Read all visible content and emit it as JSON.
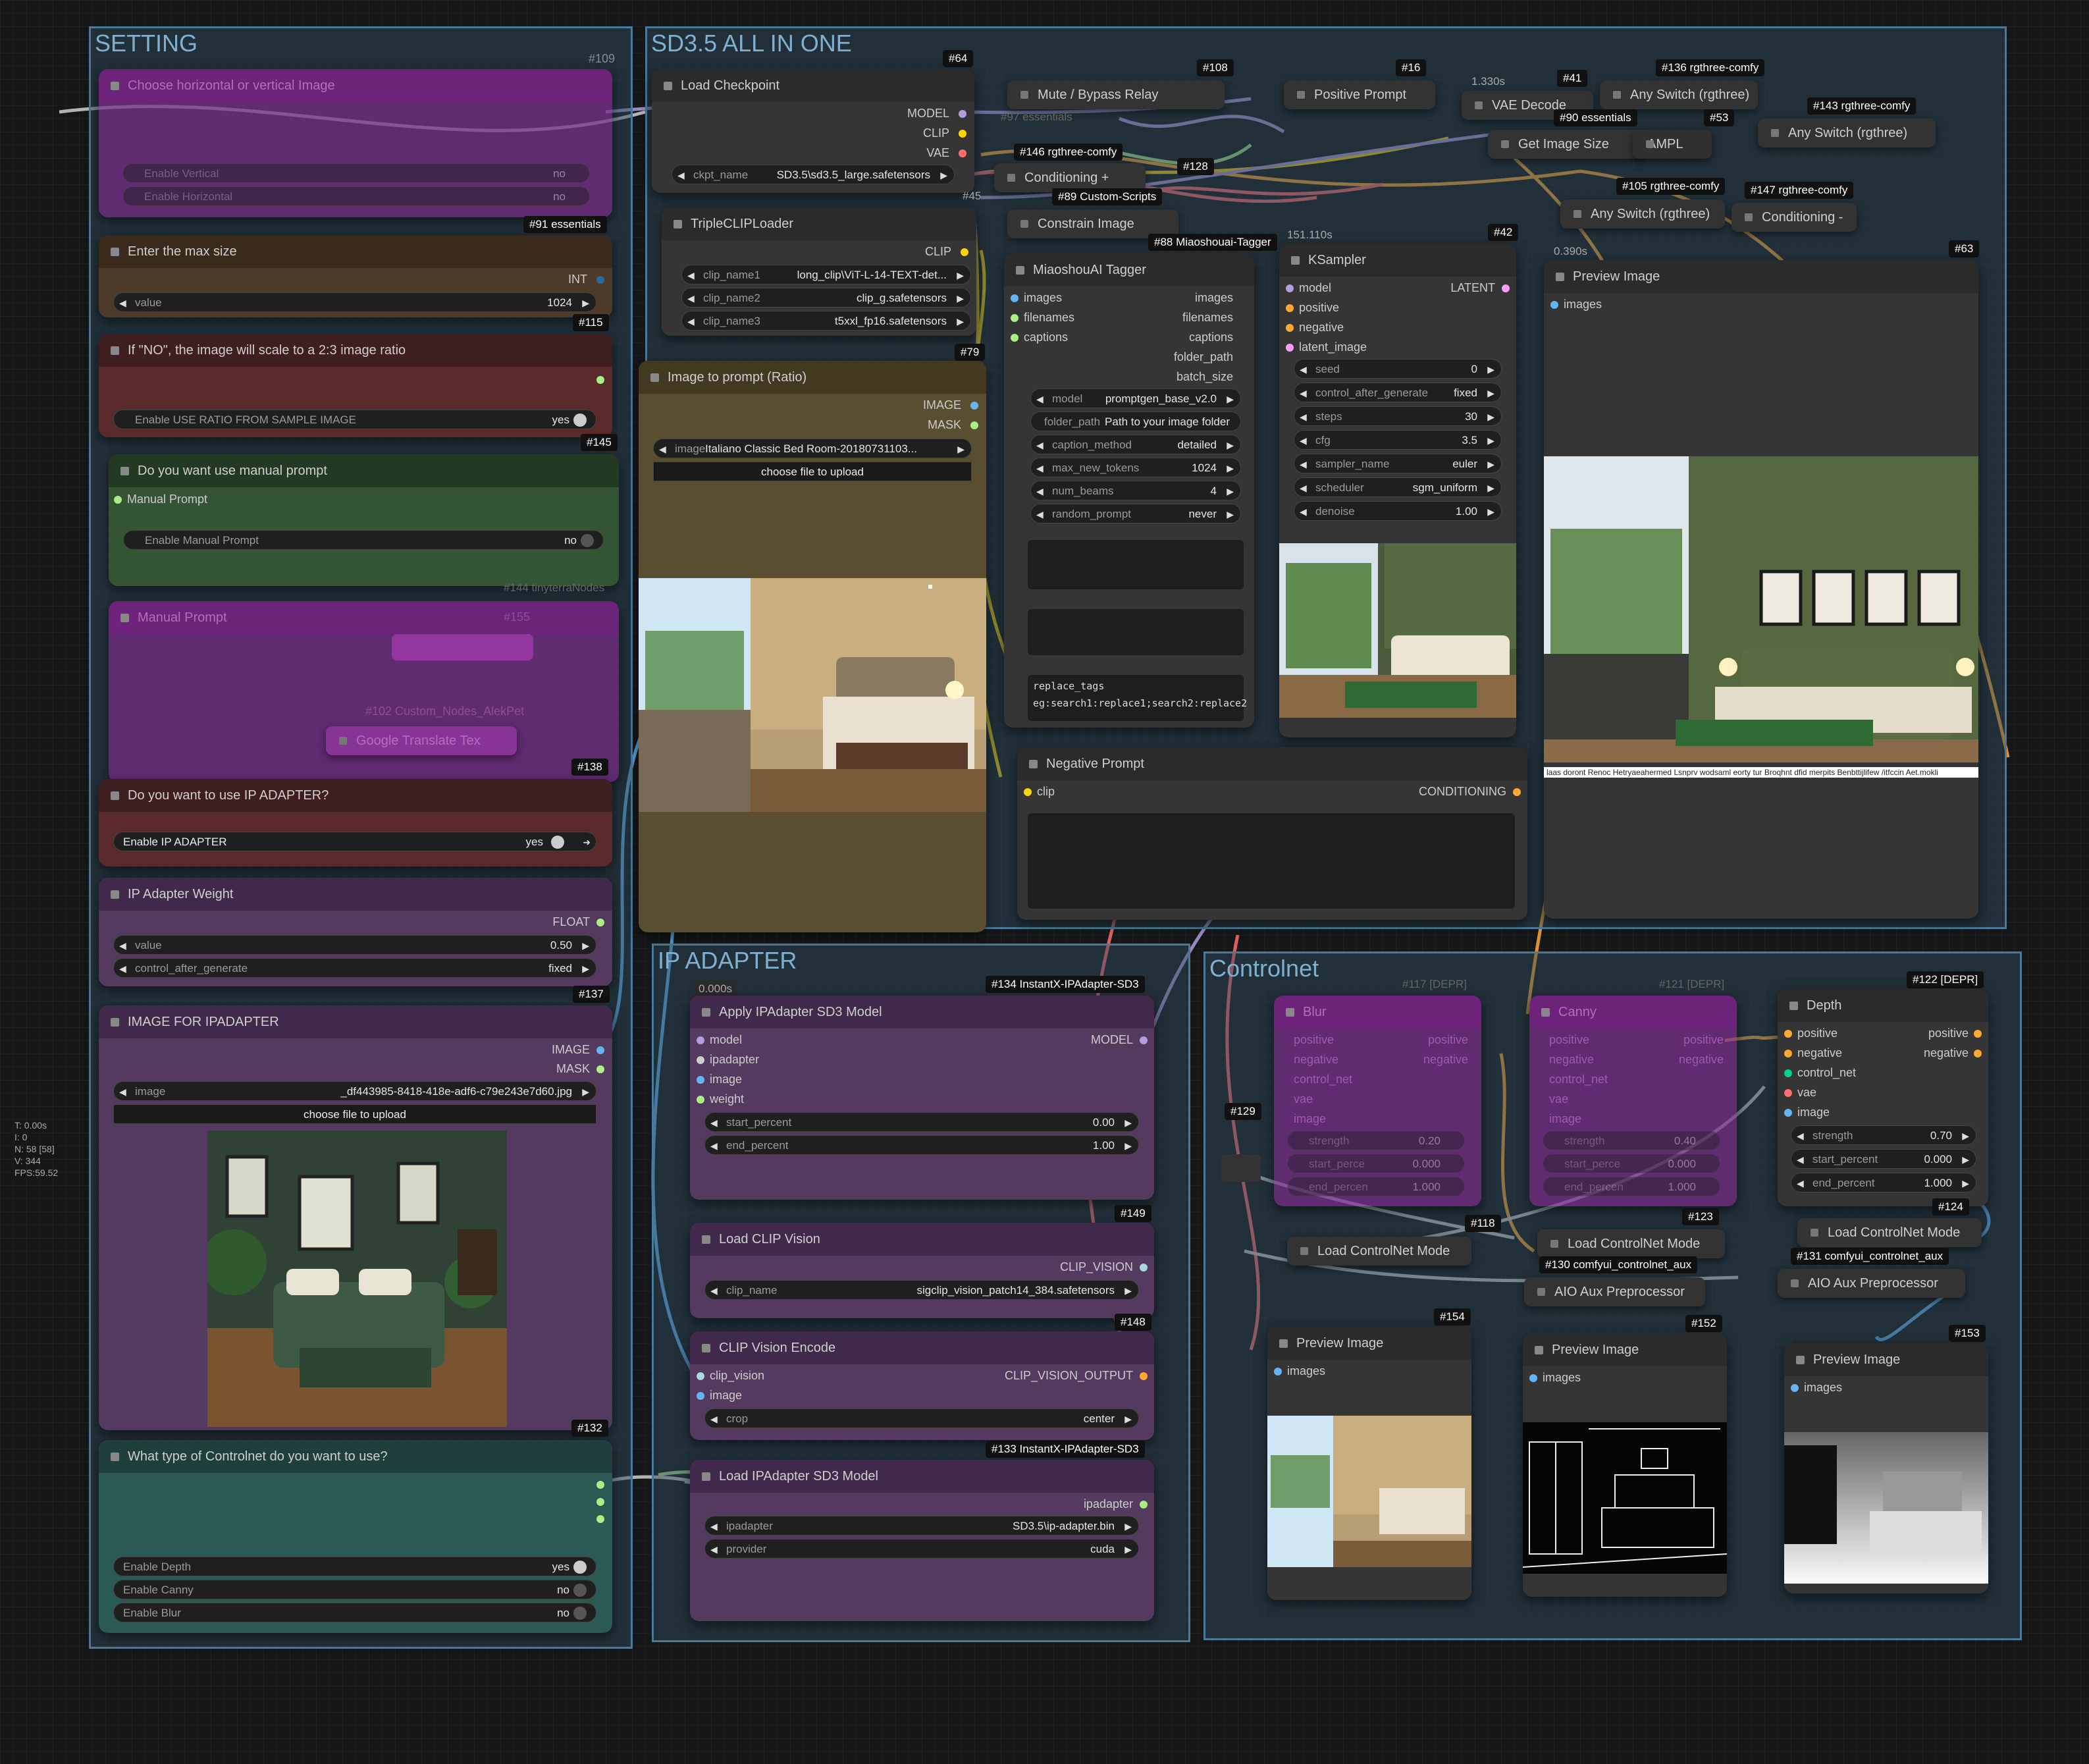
{
  "groups": {
    "setting": {
      "title": "SETTING",
      "id": "#109"
    },
    "sd35": {
      "title": "SD3.5 ALL IN ONE"
    },
    "ipadapter": {
      "title": "IP ADAPTER"
    },
    "controlnet": {
      "title": "Controlnet"
    }
  },
  "setting": {
    "orientation": {
      "title": "Choose horizontal or vertical Image",
      "enable_vertical_label": "Enable Vertical",
      "enable_vertical": "no",
      "enable_horizontal_label": "Enable Horizontal",
      "enable_horizontal": "no",
      "badge": "#91 essentials"
    },
    "max_size": {
      "title": "Enter the max size",
      "out": "INT",
      "label": "value",
      "value": "1024",
      "badge": "#115"
    },
    "ratio": {
      "title": "If \"NO\", the image will scale to a 2:3 image ratio",
      "label": "Enable USE RATIO FROM SAMPLE IMAGE",
      "value": "yes",
      "badge": "#145"
    },
    "manual": {
      "title": "Do you want use manual prompt",
      "in": "Manual Prompt",
      "label": "Enable Manual Prompt",
      "value": "no",
      "ghost": "#144 tinyterraNodes"
    },
    "manual_prompt": {
      "title": "Manual Prompt",
      "id155": "#155",
      "ghost": "#102 Custom_Nodes_AlekPet",
      "translate": "Google Translate Tex",
      "badge": "#138"
    },
    "use_ip": {
      "title": "Do you want to use IP ADAPTER?",
      "label": "Enable IP ADAPTER",
      "value": "yes"
    },
    "ip_weight": {
      "title": "IP Adapter Weight",
      "out": "FLOAT",
      "label": "value",
      "value": "0.50",
      "cag_label": "control_after_generate",
      "cag": "fixed",
      "badge": "#137"
    },
    "image_ip": {
      "title": "IMAGE FOR IPADAPTER",
      "out_image": "IMAGE",
      "out_mask": "MASK",
      "label": "image",
      "value": "_df443985-8418-418e-adf6-c79e243e7d60.jpg",
      "upload": "choose file to upload",
      "badge": "#132"
    },
    "cn_type": {
      "title": "What type of Controlnet do you want to use?",
      "depth_label": "Enable Depth",
      "depth": "yes",
      "canny_label": "Enable Canny",
      "canny": "no",
      "blur_label": "Enable Blur",
      "blur": "no"
    }
  },
  "sd": {
    "checkpoint": {
      "badge": "#64",
      "title": "Load Checkpoint",
      "out_model": "MODEL",
      "out_clip": "CLIP",
      "out_vae": "VAE",
      "label": "ckpt_name",
      "value": "SD3.5\\sd3.5_large.safetensors"
    },
    "triple": {
      "title": "TripleCLIPLoader",
      "out": "CLIP",
      "c1l": "clip_name1",
      "c1": "long_clip\\ViT-L-14-TEXT-det...",
      "c2l": "clip_name2",
      "c2": "clip_g.safetensors",
      "c3l": "clip_name3",
      "c3": "t5xxl_fp16.safetensors",
      "badge": "#79"
    },
    "img2prompt": {
      "title": "Image to prompt (Ratio)",
      "out_image": "IMAGE",
      "out_mask": "MASK",
      "label": "image",
      "value": "Italiano Classic Bed Room-20180731103...",
      "upload": "choose file to upload"
    },
    "tagger": {
      "badge": "#88 Miaoshouai-Tagger",
      "title": "MiaoshouAI Tagger",
      "in_images": "images",
      "in_filenames": "filenames",
      "in_captions": "captions",
      "out_images": "images",
      "out_filenames": "filenames",
      "out_captions": "captions",
      "out_folder": "folder_path",
      "out_batch": "batch_size",
      "model_l": "model",
      "model": "promptgen_base_v2.0",
      "folder_l": "folder_path",
      "folder": "Path to your image folder",
      "caption_l": "caption_method",
      "caption": "detailed",
      "tokens_l": "max_new_tokens",
      "tokens": "1024",
      "beams_l": "num_beams",
      "beams": "4",
      "random_l": "random_prompt",
      "random": "never",
      "replace1": "replace_tags",
      "replace2": "eg:search1:replace1;search2:replace2"
    },
    "ksampler": {
      "time": "151.110s",
      "badge": "#42",
      "title": "KSampler",
      "in_model": "model",
      "in_pos": "positive",
      "in_neg": "negative",
      "in_latent": "latent_image",
      "out": "LATENT",
      "seed_l": "seed",
      "seed": "0",
      "cag_l": "control_after_generate",
      "cag": "fixed",
      "steps_l": "steps",
      "steps": "30",
      "cfg_l": "cfg",
      "cfg": "3.5",
      "sampler_l": "sampler_name",
      "sampler": "euler",
      "sched_l": "scheduler",
      "sched": "sgm_uniform",
      "denoise_l": "denoise",
      "denoise": "1.00"
    },
    "preview": {
      "time": "0.390s",
      "badge": "#63",
      "title": "Preview Image",
      "in": "images",
      "caption": "laas doront Renoc Hetryaeahermed Lsnprv wodsaml eorty tur Broqhnt dfid merpits Benbttijlifew /itfccin Aet.mokli"
    },
    "negative": {
      "title": "Negative Prompt",
      "in": "clip",
      "out": "CONDITIONING"
    },
    "minis": {
      "mute": "Mute / Bypass Relay",
      "mute_id": "#108",
      "positive": "Positive Prompt",
      "positive_id": "#16",
      "vae": "VAE Decode",
      "vae_time": "1.330s",
      "vae_id": "#41",
      "anyswitch1": "Any Switch (rgthree)",
      "anyswitch1_id": "#136 rgthree-comfy",
      "anyswitch2": "Any Switch (rgthree)",
      "anyswitch2_id": "#143 rgthree-comfy",
      "getsize": "Get Image Size",
      "getsize_id": "#90 essentials",
      "getsize_id2": "#53",
      "sampl": "AMPL",
      "cond": "Conditioning +",
      "cond_id": "#146 rgthree-comfy",
      "cond_id2": "#128",
      "constrain": "Constrain Image",
      "constrain_id": "#89 Custom-Scripts",
      "constrain_id2": "#45",
      "anyswitch3": "Any Switch (rgthree)",
      "anyswitch3_id": "#105 rgthree-comfy",
      "cond2": "Conditioning -",
      "cond2_id": "#147 rgthree-comfy",
      "ghost": "#97 essentials",
      "ghost2": "#90 essentials"
    }
  },
  "ip": {
    "apply": {
      "time": "0.000s",
      "badge": "#134 InstantX-IPAdapter-SD3",
      "title": "Apply IPAdapter SD3 Model",
      "in_model": "model",
      "in_ip": "ipadapter",
      "in_image": "image",
      "in_weight": "weight",
      "out": "MODEL",
      "start_l": "start_percent",
      "start": "0.00",
      "end_l": "end_percent",
      "end": "1.00",
      "badge2": "#149"
    },
    "clipvision": {
      "title": "Load CLIP Vision",
      "out": "CLIP_VISION",
      "label": "clip_name",
      "value": "sigclip_vision_patch14_384.safetensors",
      "badge": "#148"
    },
    "encode": {
      "title": "CLIP Vision Encode",
      "in1": "clip_vision",
      "in2": "image",
      "out": "CLIP_VISION_OUTPUT",
      "label": "crop",
      "value": "center"
    },
    "loader": {
      "badge": "#133 InstantX-IPAdapter-SD3",
      "title": "Load IPAdapter SD3 Model",
      "out": "ipadapter",
      "ipl": "ipadapter",
      "ipv": "SD3.5\\ip-adapter.bin",
      "pl": "provider",
      "pv": "cuda"
    }
  },
  "cn": {
    "blur": {
      "id": "#117 [DEPR]",
      "title": "Blur",
      "pos": "positive",
      "neg": "negative",
      "cnet": "control_net",
      "vae": "vae",
      "img": "image",
      "strength": "0.20",
      "start": "0.000",
      "end": "1.000",
      "l1": "strength",
      "l2": "start_perce",
      "l3": "end_percen"
    },
    "canny": {
      "id": "#121 [DEPR]",
      "title": "Canny",
      "pos": "positive",
      "neg": "negative",
      "cnet": "control_net",
      "vae": "vae",
      "img": "image",
      "strength": "0.40",
      "start": "0.000",
      "end": "1.000",
      "l1": "strength",
      "l2": "start_perce",
      "l3": "end_percen"
    },
    "depth": {
      "id": "#122 [DEPR]",
      "title": "Depth",
      "in_pos": "positive",
      "in_neg": "negative",
      "in_cn": "control_net",
      "in_vae": "vae",
      "in_img": "image",
      "out_pos": "positive",
      "out_neg": "negative",
      "strength_l": "strength",
      "strength": "0.70",
      "start_l": "start_percent",
      "start": "0.000",
      "end_l": "end_percent",
      "end": "1.000"
    },
    "minis": {
      "cn1": "Load ControlNet Mode",
      "cn1_id": "#118",
      "cn2": "Load ControlNet Mode",
      "cn2_id": "#123",
      "cn3": "Load ControlNet Mode",
      "cn3_id": "#124",
      "aux1": "AIO Aux Preprocessor",
      "aux1_id": "#130 comfyui_controlnet_aux",
      "aux2": "AIO Aux Preprocessor",
      "aux2_id": "#131 comfyui_controlnet_aux",
      "reroute": "#129"
    },
    "prev1": {
      "badge": "#154",
      "title": "Preview Image",
      "in": "images"
    },
    "prev2": {
      "badge": "#152",
      "title": "Preview Image",
      "in": "images"
    },
    "prev3": {
      "badge": "#153",
      "title": "Preview Image",
      "in": "images"
    }
  },
  "stats": {
    "t": "T: 0.00s",
    "i": "I: 0",
    "n": "N: 58 [58]",
    "v": "V: 344",
    "fps": "FPS:59.52"
  },
  "colors": {
    "accent": "#7fb0d0",
    "model": "#b39ddb",
    "clip": "#ffd500",
    "vae": "#ff6e6e",
    "image": "#64b5f6",
    "conditioning": "#ffa931",
    "int": "#29699c",
    "float": "#aaee88"
  }
}
